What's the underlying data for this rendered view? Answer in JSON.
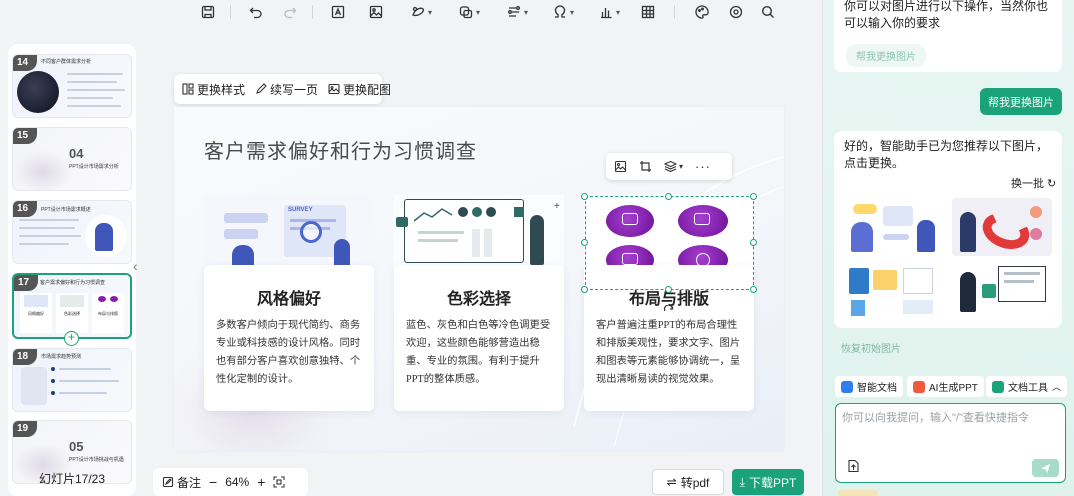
{
  "toolbar": {
    "icons": [
      "save-icon",
      "undo-icon",
      "redo-icon",
      "text-box-icon",
      "image-icon",
      "shape-icon",
      "smart-shape-icon",
      "flowchart-icon",
      "symbol-icon",
      "chart-icon",
      "table-icon",
      "palette-icon",
      "target-icon",
      "search-icon"
    ]
  },
  "thumbnails": {
    "slides": [
      {
        "num": "14",
        "heading": "不同客户群体需求分析"
      },
      {
        "num": "15",
        "big": "04",
        "sub": "PPT设计市场需求分析"
      },
      {
        "num": "16",
        "heading": "PPT设计市场需求概述"
      },
      {
        "num": "17",
        "heading": "客户需求偏好和行为习惯调查",
        "labels": [
          "风格偏好",
          "色彩选择",
          "布局与排版"
        ]
      },
      {
        "num": "18",
        "heading": "市场需求趋势预测"
      },
      {
        "num": "19",
        "big": "05",
        "sub": "PPT设计市场挑战与机遇"
      }
    ],
    "counter": "幻灯片17/23"
  },
  "float_bar": {
    "change_style": "更换样式",
    "continue_page": "续写一页",
    "change_image": "更换配图"
  },
  "slide": {
    "title": "客户需求偏好和行为习惯调查",
    "survey_label": "SURVEY",
    "cards": [
      {
        "title": "风格偏好",
        "body": "多数客户倾向于现代简约、商务专业或科技感的设计风格。同时也有部分客户喜欢创意独特、个性化定制的设计。"
      },
      {
        "title": "色彩选择",
        "body": "蓝色、灰色和白色等冷色调更受欢迎，这些颜色能够营造出稳重、专业的氛围。有利于提升PPT的整体质感。"
      },
      {
        "title": "布局与排版",
        "body": "客户普遍注重PPT的布局合理性和排版美观性，要求文字、图片和图表等元素能够协调统一，呈现出清晰易读的视觉效果。"
      }
    ]
  },
  "bottom_bar": {
    "notes": "备注",
    "zoom": "64%",
    "to_pdf": "转pdf",
    "download": "下载PPT"
  },
  "right_panel": {
    "intro_text": "你可以对图片进行以下操作，当然你也可以输入你的要求",
    "chip_label": "帮我更换图片",
    "user_message": "帮我更换图片",
    "assistant_text": "好的，智能助手已为您推荐以下图片，点击更换。",
    "refresh_label": "换一批",
    "restore_label": "恢复初始图片",
    "quick_actions": [
      {
        "label": "智能文档",
        "color": "#2f7ff0"
      },
      {
        "label": "AI生成PPT",
        "color": "#f05a3c"
      },
      {
        "label": "文档工具",
        "color": "#1aa37a"
      }
    ],
    "input_placeholder": "你可以向我提问，输入\"/\"查看快捷指令"
  },
  "colors": {
    "accent": "#1aa37a",
    "panel_bg": "#e3f4ee"
  }
}
